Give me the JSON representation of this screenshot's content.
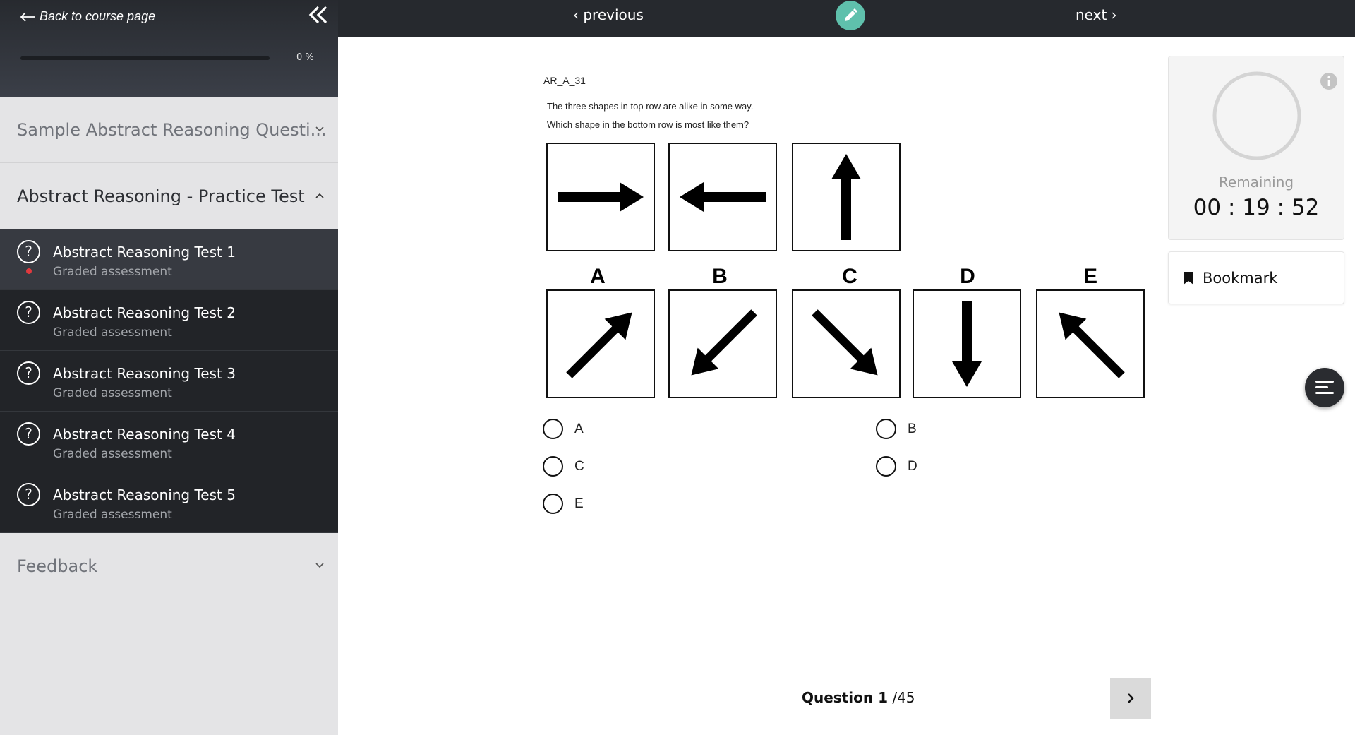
{
  "sidebar": {
    "back_label": "Back to course page",
    "progress_percent_label": "0 %",
    "progress_fraction": 0,
    "sections": [
      {
        "title": "Sample Abstract Reasoning Questi...",
        "expanded": false
      },
      {
        "title": "Abstract Reasoning - Practice Test",
        "expanded": true
      },
      {
        "title": "Feedback",
        "expanded": false
      }
    ],
    "lessons": [
      {
        "title": "Abstract Reasoning Test 1",
        "subtitle": "Graded assessment",
        "current": true
      },
      {
        "title": "Abstract Reasoning Test 2",
        "subtitle": "Graded assessment",
        "current": false
      },
      {
        "title": "Abstract Reasoning Test 3",
        "subtitle": "Graded assessment",
        "current": false
      },
      {
        "title": "Abstract Reasoning Test 4",
        "subtitle": "Graded assessment",
        "current": false
      },
      {
        "title": "Abstract Reasoning Test 5",
        "subtitle": "Graded assessment",
        "current": false
      }
    ]
  },
  "topbar": {
    "previous_label": "‹ previous",
    "next_label": "next ›",
    "edit_icon": "pencil-icon",
    "accent_color": "#5fc0ac"
  },
  "question": {
    "id": "AR_A_31",
    "line1": "The three shapes in top row are alike in some way.",
    "line2": "Which shape in the bottom row is most like them?",
    "top_row": [
      "arrow-right",
      "arrow-left",
      "arrow-up"
    ],
    "options": [
      {
        "label": "A",
        "figure": "arrow-up-right"
      },
      {
        "label": "B",
        "figure": "arrow-down-left"
      },
      {
        "label": "C",
        "figure": "arrow-down-right"
      },
      {
        "label": "D",
        "figure": "arrow-down"
      },
      {
        "label": "E",
        "figure": "arrow-up-left"
      }
    ],
    "answer_choices": [
      "A",
      "B",
      "C",
      "D",
      "E"
    ]
  },
  "timer": {
    "remaining_label": "Remaining",
    "time": "00 : 19 : 52"
  },
  "bookmark": {
    "label": "Bookmark"
  },
  "footer": {
    "question_word": "Question 1",
    "total": " /45"
  }
}
